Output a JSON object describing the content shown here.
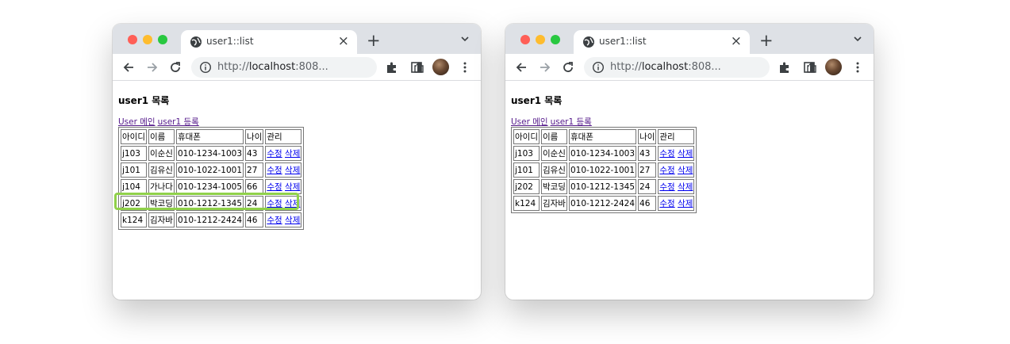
{
  "left_window": {
    "tab_title": "user1::list",
    "url_prefix": "http://",
    "url_host": "localhost",
    "url_rest": ":808...",
    "heading": "user1 목록",
    "link_main": "User 메인",
    "link_register": "user1 등록",
    "headers": [
      "아이디",
      "이름",
      "휴대폰",
      "나이",
      "관리"
    ],
    "rows": [
      {
        "id": "j103",
        "name": "이순신",
        "phone": "010-1234-1003",
        "age": "43",
        "edit": "수정",
        "delete": "삭제"
      },
      {
        "id": "j101",
        "name": "김유신",
        "phone": "010-1022-1001",
        "age": "27",
        "edit": "수정",
        "delete": "삭제"
      },
      {
        "id": "j104",
        "name": "가나다",
        "phone": "010-1234-1005",
        "age": "66",
        "edit": "수정",
        "delete": "삭제",
        "highlighted": true
      },
      {
        "id": "j202",
        "name": "박코딩",
        "phone": "010-1212-1345",
        "age": "24",
        "edit": "수정",
        "delete": "삭제"
      },
      {
        "id": "k124",
        "name": "김자바",
        "phone": "010-1212-2424",
        "age": "46",
        "edit": "수정",
        "delete": "삭제"
      }
    ]
  },
  "right_window": {
    "tab_title": "user1::list",
    "url_prefix": "http://",
    "url_host": "localhost",
    "url_rest": ":808...",
    "heading": "user1 목록",
    "link_main": "User 메인",
    "link_register": "user1 등록",
    "headers": [
      "아이디",
      "이름",
      "휴대폰",
      "나이",
      "관리"
    ],
    "rows": [
      {
        "id": "j103",
        "name": "이순신",
        "phone": "010-1234-1003",
        "age": "43",
        "edit": "수정",
        "delete": "삭제"
      },
      {
        "id": "j101",
        "name": "김유신",
        "phone": "010-1022-1001",
        "age": "27",
        "edit": "수정",
        "delete": "삭제"
      },
      {
        "id": "j202",
        "name": "박코딩",
        "phone": "010-1212-1345",
        "age": "24",
        "edit": "수정",
        "delete": "삭제"
      },
      {
        "id": "k124",
        "name": "김자바",
        "phone": "010-1212-2424",
        "age": "46",
        "edit": "수정",
        "delete": "삭제"
      }
    ]
  },
  "colors": {
    "highlight": "#90d14a",
    "tabstrip": "#dee1e6",
    "visited_link": "#551a8b",
    "link": "#0000ee"
  },
  "icons": [
    "globe-icon",
    "close-icon",
    "plus-icon",
    "chevron-down-icon",
    "back-arrow-icon",
    "forward-arrow-icon",
    "reload-icon",
    "info-icon",
    "share-icon",
    "star-icon",
    "puzzle-icon",
    "side-panel-icon",
    "avatar",
    "kebab-menu-icon"
  ]
}
